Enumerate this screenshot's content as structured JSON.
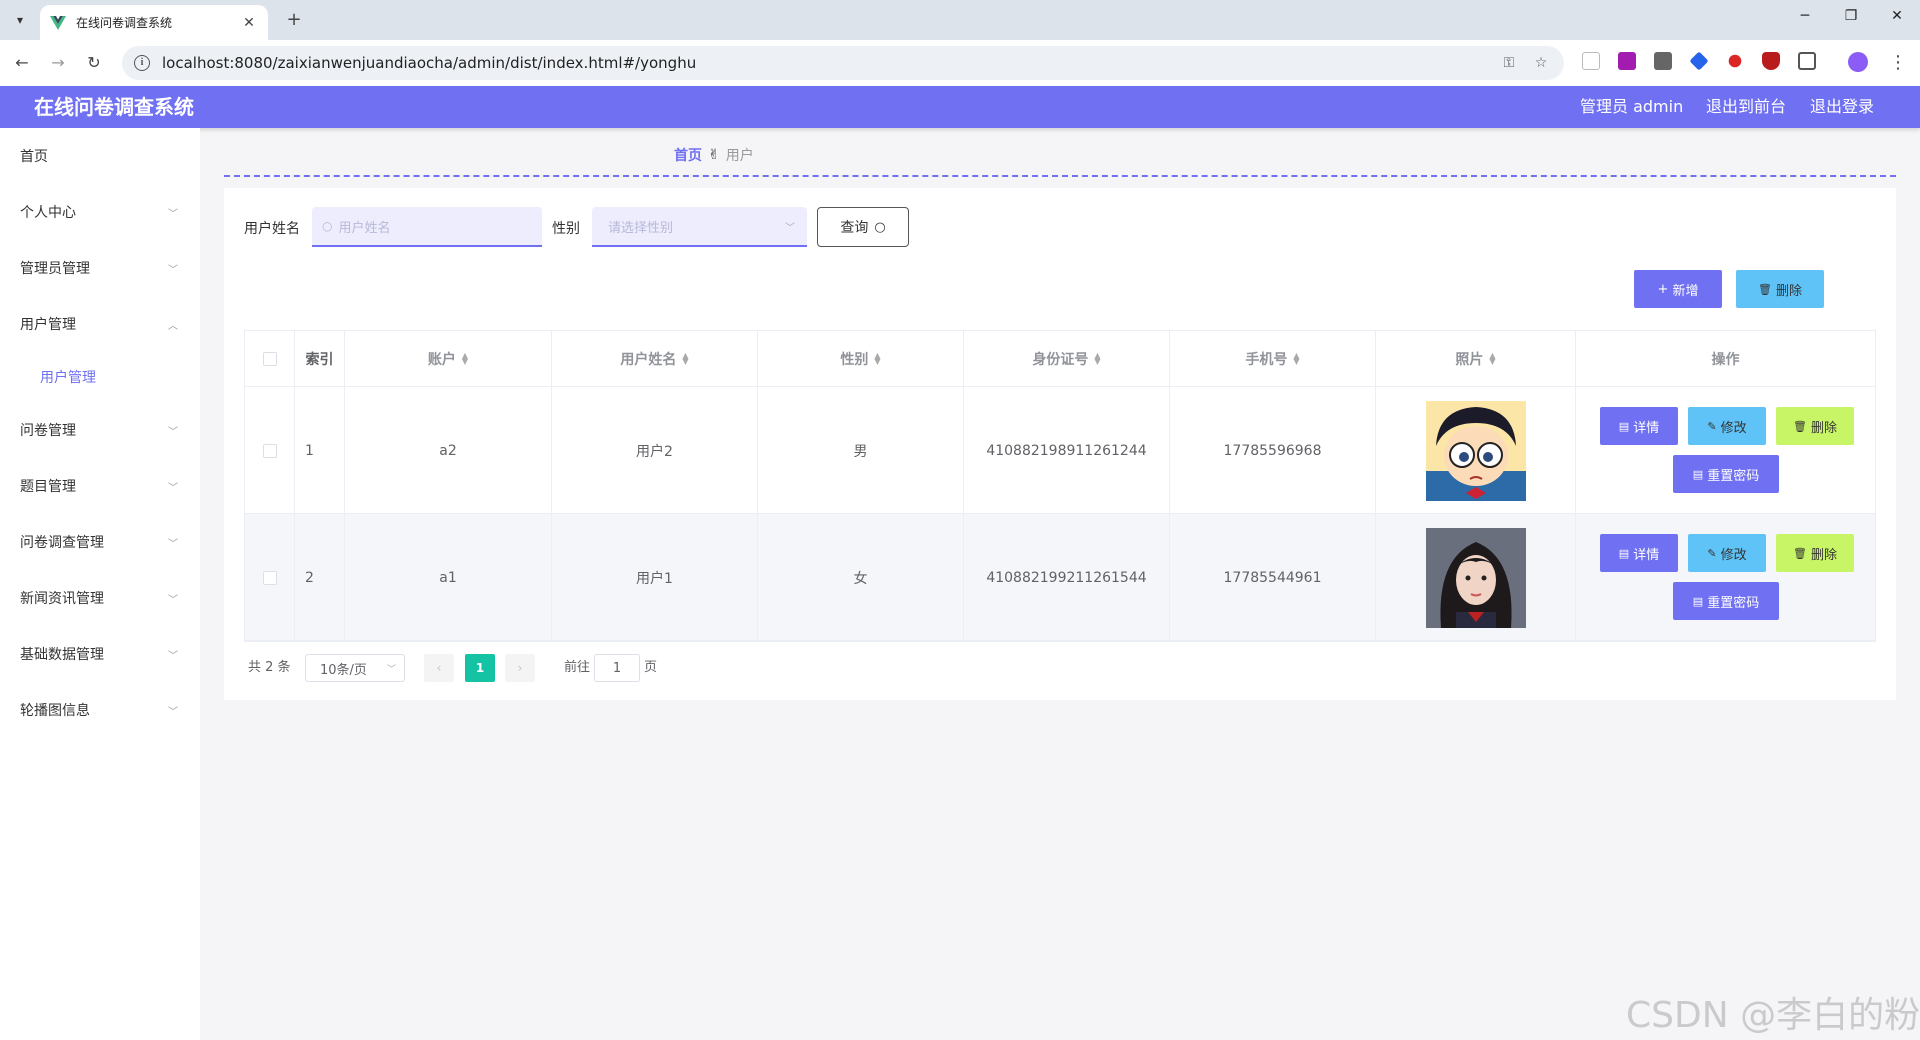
{
  "browser": {
    "tab_title": "在线问卷调查系统",
    "url": "localhost:8080/zaixianwenjuandiaocha/admin/dist/index.html#/yonghu"
  },
  "header": {
    "title": "在线问卷调查系统",
    "admin_label": "管理员 admin",
    "frontend_link": "退出到前台",
    "logout_link": "退出登录"
  },
  "sidebar": {
    "items": [
      {
        "label": "首页"
      },
      {
        "label": "个人中心"
      },
      {
        "label": "管理员管理"
      },
      {
        "label": "用户管理"
      },
      {
        "label": "问卷管理"
      },
      {
        "label": "题目管理"
      },
      {
        "label": "问卷调查管理"
      },
      {
        "label": "新闻资讯管理"
      },
      {
        "label": "基础数据管理"
      },
      {
        "label": "轮播图信息"
      }
    ],
    "sub_items": [
      {
        "label": "用户管理"
      }
    ]
  },
  "breadcrumb": {
    "home": "首页",
    "current": "用户"
  },
  "search": {
    "name_label": "用户姓名",
    "name_placeholder": "用户姓名",
    "gender_label": "性别",
    "gender_placeholder": "请选择性别",
    "query_button": "查询"
  },
  "actions": {
    "add_button": "新增",
    "delete_button": "删除"
  },
  "table": {
    "headers": [
      "索引",
      "账户",
      "用户姓名",
      "性别",
      "身份证号",
      "手机号",
      "照片",
      "操作"
    ],
    "rows": [
      {
        "index": "1",
        "account": "a2",
        "name": "用户2",
        "gender": "男",
        "id_card": "410882198911261244",
        "phone": "17785596968"
      },
      {
        "index": "2",
        "account": "a1",
        "name": "用户1",
        "gender": "女",
        "id_card": "410882199211261544",
        "phone": "17785544961"
      }
    ],
    "row_buttons": {
      "detail": "详情",
      "edit": "修改",
      "delete": "删除",
      "reset_password": "重置密码"
    }
  },
  "pagination": {
    "total": "共 2 条",
    "page_size": "10条/页",
    "current_page": "1",
    "goto_label": "前往",
    "goto_value": "1",
    "page_suffix": "页"
  },
  "watermark": "CSDN @李白的粉",
  "colors": {
    "primary": "#7070f2",
    "info": "#5fc3f7",
    "lime": "#c7f565",
    "pager_active": "#13c3a3"
  }
}
